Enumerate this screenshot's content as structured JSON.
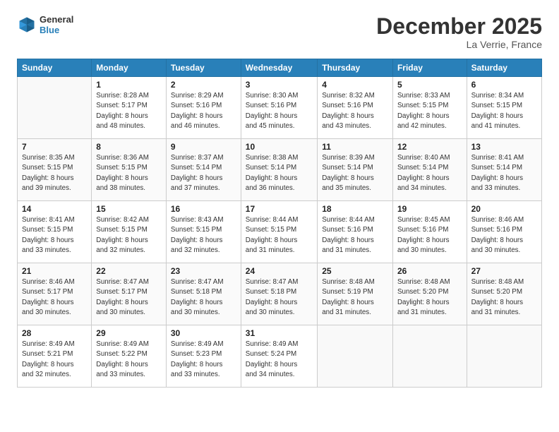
{
  "header": {
    "logo_general": "General",
    "logo_blue": "Blue",
    "month": "December 2025",
    "location": "La Verrie, France"
  },
  "days_of_week": [
    "Sunday",
    "Monday",
    "Tuesday",
    "Wednesday",
    "Thursday",
    "Friday",
    "Saturday"
  ],
  "weeks": [
    [
      {
        "day": "",
        "info": ""
      },
      {
        "day": "1",
        "info": "Sunrise: 8:28 AM\nSunset: 5:17 PM\nDaylight: 8 hours\nand 48 minutes."
      },
      {
        "day": "2",
        "info": "Sunrise: 8:29 AM\nSunset: 5:16 PM\nDaylight: 8 hours\nand 46 minutes."
      },
      {
        "day": "3",
        "info": "Sunrise: 8:30 AM\nSunset: 5:16 PM\nDaylight: 8 hours\nand 45 minutes."
      },
      {
        "day": "4",
        "info": "Sunrise: 8:32 AM\nSunset: 5:16 PM\nDaylight: 8 hours\nand 43 minutes."
      },
      {
        "day": "5",
        "info": "Sunrise: 8:33 AM\nSunset: 5:15 PM\nDaylight: 8 hours\nand 42 minutes."
      },
      {
        "day": "6",
        "info": "Sunrise: 8:34 AM\nSunset: 5:15 PM\nDaylight: 8 hours\nand 41 minutes."
      }
    ],
    [
      {
        "day": "7",
        "info": "Sunrise: 8:35 AM\nSunset: 5:15 PM\nDaylight: 8 hours\nand 39 minutes."
      },
      {
        "day": "8",
        "info": "Sunrise: 8:36 AM\nSunset: 5:15 PM\nDaylight: 8 hours\nand 38 minutes."
      },
      {
        "day": "9",
        "info": "Sunrise: 8:37 AM\nSunset: 5:14 PM\nDaylight: 8 hours\nand 37 minutes."
      },
      {
        "day": "10",
        "info": "Sunrise: 8:38 AM\nSunset: 5:14 PM\nDaylight: 8 hours\nand 36 minutes."
      },
      {
        "day": "11",
        "info": "Sunrise: 8:39 AM\nSunset: 5:14 PM\nDaylight: 8 hours\nand 35 minutes."
      },
      {
        "day": "12",
        "info": "Sunrise: 8:40 AM\nSunset: 5:14 PM\nDaylight: 8 hours\nand 34 minutes."
      },
      {
        "day": "13",
        "info": "Sunrise: 8:41 AM\nSunset: 5:14 PM\nDaylight: 8 hours\nand 33 minutes."
      }
    ],
    [
      {
        "day": "14",
        "info": "Sunrise: 8:41 AM\nSunset: 5:15 PM\nDaylight: 8 hours\nand 33 minutes."
      },
      {
        "day": "15",
        "info": "Sunrise: 8:42 AM\nSunset: 5:15 PM\nDaylight: 8 hours\nand 32 minutes."
      },
      {
        "day": "16",
        "info": "Sunrise: 8:43 AM\nSunset: 5:15 PM\nDaylight: 8 hours\nand 32 minutes."
      },
      {
        "day": "17",
        "info": "Sunrise: 8:44 AM\nSunset: 5:15 PM\nDaylight: 8 hours\nand 31 minutes."
      },
      {
        "day": "18",
        "info": "Sunrise: 8:44 AM\nSunset: 5:16 PM\nDaylight: 8 hours\nand 31 minutes."
      },
      {
        "day": "19",
        "info": "Sunrise: 8:45 AM\nSunset: 5:16 PM\nDaylight: 8 hours\nand 30 minutes."
      },
      {
        "day": "20",
        "info": "Sunrise: 8:46 AM\nSunset: 5:16 PM\nDaylight: 8 hours\nand 30 minutes."
      }
    ],
    [
      {
        "day": "21",
        "info": "Sunrise: 8:46 AM\nSunset: 5:17 PM\nDaylight: 8 hours\nand 30 minutes."
      },
      {
        "day": "22",
        "info": "Sunrise: 8:47 AM\nSunset: 5:17 PM\nDaylight: 8 hours\nand 30 minutes."
      },
      {
        "day": "23",
        "info": "Sunrise: 8:47 AM\nSunset: 5:18 PM\nDaylight: 8 hours\nand 30 minutes."
      },
      {
        "day": "24",
        "info": "Sunrise: 8:47 AM\nSunset: 5:18 PM\nDaylight: 8 hours\nand 30 minutes."
      },
      {
        "day": "25",
        "info": "Sunrise: 8:48 AM\nSunset: 5:19 PM\nDaylight: 8 hours\nand 31 minutes."
      },
      {
        "day": "26",
        "info": "Sunrise: 8:48 AM\nSunset: 5:20 PM\nDaylight: 8 hours\nand 31 minutes."
      },
      {
        "day": "27",
        "info": "Sunrise: 8:48 AM\nSunset: 5:20 PM\nDaylight: 8 hours\nand 31 minutes."
      }
    ],
    [
      {
        "day": "28",
        "info": "Sunrise: 8:49 AM\nSunset: 5:21 PM\nDaylight: 8 hours\nand 32 minutes."
      },
      {
        "day": "29",
        "info": "Sunrise: 8:49 AM\nSunset: 5:22 PM\nDaylight: 8 hours\nand 33 minutes."
      },
      {
        "day": "30",
        "info": "Sunrise: 8:49 AM\nSunset: 5:23 PM\nDaylight: 8 hours\nand 33 minutes."
      },
      {
        "day": "31",
        "info": "Sunrise: 8:49 AM\nSunset: 5:24 PM\nDaylight: 8 hours\nand 34 minutes."
      },
      {
        "day": "",
        "info": ""
      },
      {
        "day": "",
        "info": ""
      },
      {
        "day": "",
        "info": ""
      }
    ]
  ]
}
